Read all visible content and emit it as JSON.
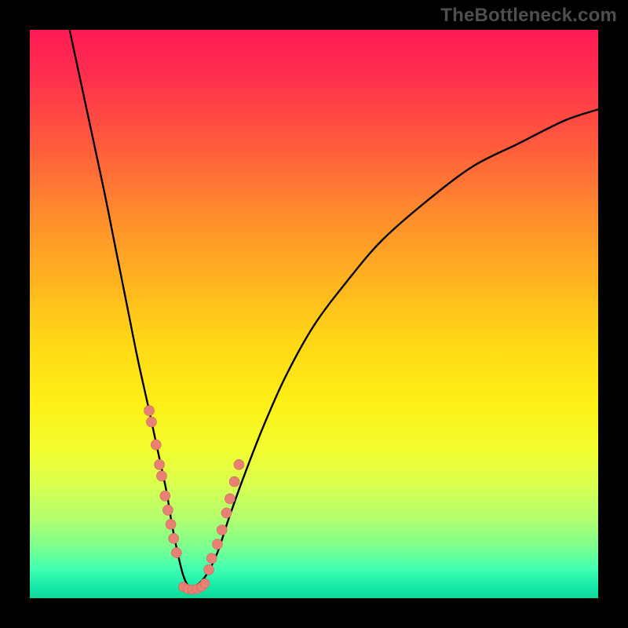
{
  "watermark": "TheBottleneck.com",
  "colors": {
    "frame": "#000000",
    "curve": "#000000",
    "dot_fill": "#e98074",
    "dot_stroke": "#c96b60"
  },
  "chart_data": {
    "type": "line",
    "title": "",
    "xlabel": "",
    "ylabel": "",
    "xlim": [
      0,
      100
    ],
    "ylim": [
      0,
      100
    ],
    "annotations": [
      "TheBottleneck.com"
    ],
    "series": [
      {
        "name": "bottleneck-curve",
        "x": [
          7,
          10,
          13,
          15,
          17,
          19,
          21,
          22.5,
          24,
          25,
          26,
          27,
          28,
          29,
          31,
          33,
          35,
          37.5,
          41,
          45,
          50,
          56,
          62,
          70,
          78,
          86,
          94,
          100
        ],
        "y": [
          100,
          86,
          72,
          62,
          52,
          42,
          33,
          26,
          19,
          13,
          8,
          4,
          2,
          2,
          4,
          8,
          14,
          21,
          30,
          39,
          48,
          56,
          63,
          70,
          76,
          80,
          84,
          86
        ]
      }
    ],
    "left_markers": {
      "name": "left-cluster",
      "x": [
        21.0,
        21.4,
        22.2,
        22.8,
        23.2,
        23.8,
        24.3,
        24.8,
        25.3,
        25.8
      ],
      "y": [
        33,
        31,
        27,
        23.5,
        21.5,
        18,
        15.5,
        13,
        10.5,
        8
      ]
    },
    "right_markers": {
      "name": "right-cluster",
      "x": [
        31.5,
        32.0,
        33.0,
        33.8,
        34.6,
        35.2,
        36.0,
        36.8
      ],
      "y": [
        5,
        7,
        9.5,
        12,
        15,
        17.5,
        20.5,
        23.5
      ]
    },
    "bottom_markers": {
      "name": "bottom-cluster",
      "x": [
        27.0,
        27.8,
        28.6,
        29.4,
        30.2,
        30.8
      ],
      "y": [
        2.0,
        1.6,
        1.5,
        1.6,
        2.0,
        2.6
      ]
    }
  }
}
